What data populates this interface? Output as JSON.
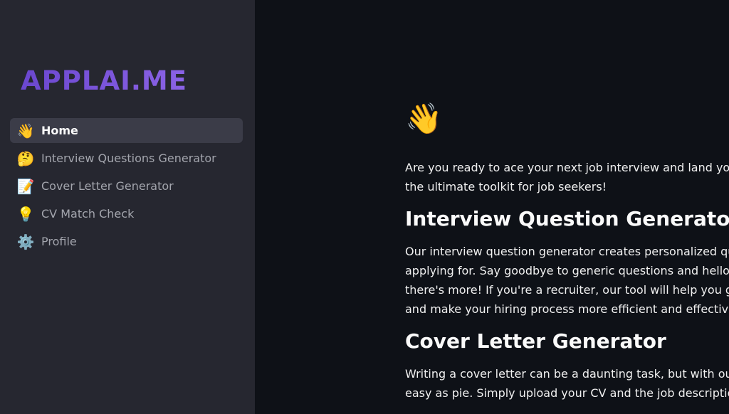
{
  "sidebar": {
    "logo_text": "APPLAI.ME",
    "items": [
      {
        "icon": "waving-hand-icon",
        "glyph": "👋",
        "label": "Home",
        "active": true
      },
      {
        "icon": "thinking-face-icon",
        "glyph": "🤔",
        "label": "Interview Questions Generator",
        "active": false
      },
      {
        "icon": "memo-icon",
        "glyph": "📝",
        "label": "Cover Letter Generator",
        "active": false
      },
      {
        "icon": "light-bulb-icon",
        "glyph": "💡",
        "label": "CV Match Check",
        "active": false
      },
      {
        "icon": "gear-icon",
        "glyph": "⚙️",
        "label": "Profile",
        "active": false
      }
    ]
  },
  "main": {
    "hero_icon": "👋",
    "intro_lines": [
      "Are you ready to ace your next job interview and land your drear",
      "the ultimate toolkit for job seekers!"
    ],
    "section1_title": "Interview Question Generator",
    "section1_lines": [
      "Our interview question generator creates personalized question",
      "applying for. Say goodbye to generic questions and hello to conf",
      "there's more! If you're a recruiter, our tool will help you generate",
      "and make your hiring process more efficient and effective)"
    ],
    "section2_title": "Cover Letter Generator",
    "section2_lines": [
      "Writing a cover letter can be a daunting task, but with our letter ,",
      "easy as pie. Simply upload your CV and the job description, and"
    ]
  },
  "colors": {
    "sidebar_bg": "#262730",
    "main_bg": "#0e1117",
    "active_item_bg": "#3b3c48",
    "logo": "#7652d6"
  }
}
